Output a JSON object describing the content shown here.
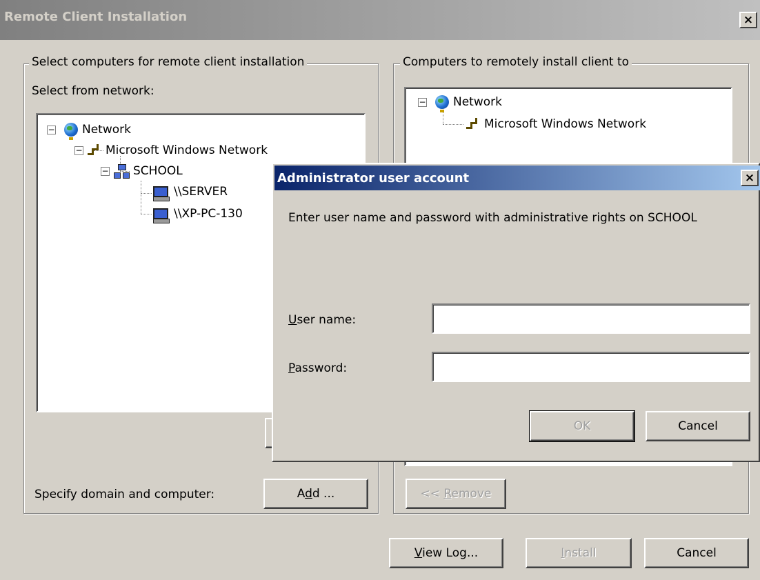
{
  "window": {
    "title": "Remote Client Installation",
    "close_label": "×"
  },
  "left_group": {
    "legend": "Select computers for remote client installation",
    "select_label": "Select from network:",
    "tree": {
      "network": "Network",
      "mwn": "Microsoft Windows Network",
      "domain": "SCHOOL",
      "server": "\\\\SERVER",
      "client": "\\\\XP-PC-130"
    },
    "specify_label": "Specify domain and computer:",
    "add_button": {
      "pre": "A",
      "key": "d",
      "post": "d ..."
    }
  },
  "right_group": {
    "legend": "Computers to remotely install client to",
    "tree": {
      "network": "Network",
      "mwn": "Microsoft Windows Network"
    },
    "remove_button": {
      "pre": "<< ",
      "key": "R",
      "post": "emove"
    }
  },
  "footer": {
    "view_log": {
      "key": "V",
      "post": "iew Log..."
    },
    "install": {
      "key": "I",
      "post": "nstall"
    },
    "cancel": "Cancel"
  },
  "dialog": {
    "title": "Administrator user account",
    "close_label": "×",
    "message": "Enter user name and password with administrative rights on SCHOOL",
    "username_label": {
      "key": "U",
      "post": "ser name:"
    },
    "username_value": "",
    "password_label": {
      "key": "P",
      "post": "assword:"
    },
    "password_value": "",
    "ok": "OK",
    "cancel": "Cancel"
  }
}
